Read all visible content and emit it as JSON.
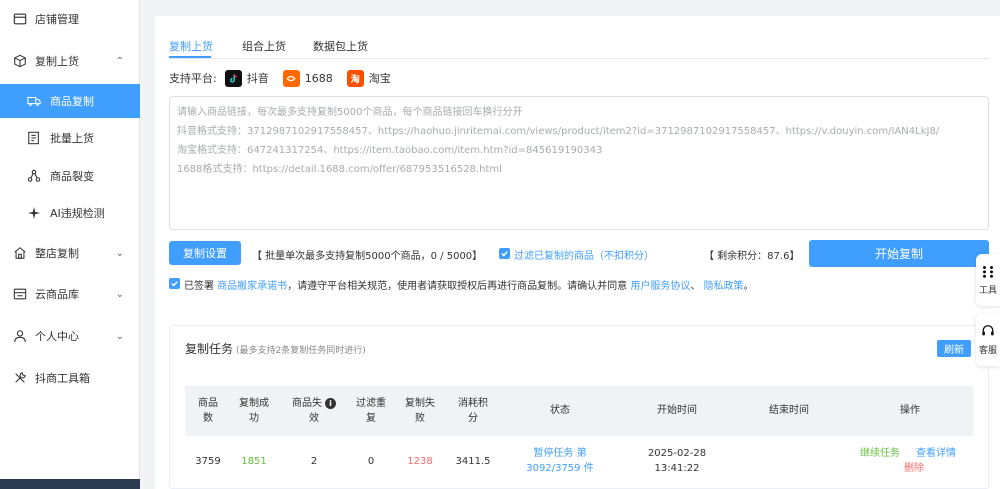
{
  "sidebar": {
    "items": [
      {
        "label": "店铺管理",
        "icon": "store-icon"
      },
      {
        "label": "复制上货",
        "icon": "box-icon",
        "arrow": "^"
      },
      {
        "label": "商品复制",
        "icon": "truck-icon",
        "active": true
      },
      {
        "label": "批量上货",
        "icon": "list-icon"
      },
      {
        "label": "商品裂变",
        "icon": "fission-icon"
      },
      {
        "label": "AI违规检测",
        "icon": "ai-check-icon"
      },
      {
        "label": "整店复制",
        "icon": "shop-copy-icon",
        "arrow": "v"
      },
      {
        "label": "云商品库",
        "icon": "cloud-library-icon",
        "arrow": "v"
      },
      {
        "label": "个人中心",
        "icon": "user-icon",
        "arrow": "v"
      },
      {
        "label": "抖商工具箱",
        "icon": "toolbox-icon"
      }
    ]
  },
  "tabs": [
    "复制上货",
    "组合上货",
    "数据包上货"
  ],
  "platforms": {
    "label": "支持平台:",
    "items": [
      {
        "name": "抖音",
        "icon": "douyin-logo-icon",
        "color": "#111111"
      },
      {
        "name": "1688",
        "icon": "alibaba-1688-logo-icon",
        "color": "#ff6a00"
      },
      {
        "name": "淘宝",
        "icon": "taobao-logo-icon",
        "color": "#ff5000",
        "glyph": "淘"
      }
    ]
  },
  "input": {
    "lines": [
      "请输入商品链接，每次最多支持复制5000个商品，每个商品链接回车换行分开",
      "抖音格式支持：3712987102917558457、https://haohuo.jinritemai.com/views/product/item2?id=3712987102917558457、https://v.douyin.com/IAN4LkJ8/",
      "淘宝格式支持：647241317254、https://item.taobao.com/item.htm?id=845619190343",
      "1688格式支持：https://detail.1688.com/offer/687953516528.html"
    ]
  },
  "actions": {
    "settings_button": "复制设置",
    "batch_limit": "【 批量单次最多支持复制5000个商品，0 / 5000】",
    "filter_copied": "过滤已复制的商品（不扣积分）",
    "points": "【 剩余积分：87.6】",
    "start_button": "开始复制"
  },
  "agreement": {
    "prefix": "已签署",
    "link1": "商品搬家承诺书",
    "middle": "，请遵守平台相关规范，使用者请获取授权后再进行商品复制。请确认并同意",
    "link2": "用户服务协议",
    "sep": "、",
    "link3": "隐私政策",
    "suffix": "。"
  },
  "tasks": {
    "title": "复制任务",
    "hint": "(最多支持2条复制任务同时进行)",
    "refresh_button": "刷新",
    "columns": [
      [
        "商品",
        "数"
      ],
      [
        "复制成",
        "功"
      ],
      [
        "商品失",
        "效"
      ],
      [
        "过滤重",
        "复"
      ],
      [
        "复制失",
        "败"
      ],
      [
        "消耗积",
        "分"
      ],
      [
        "状态"
      ],
      [
        "开始时间"
      ],
      [
        "结束时间"
      ],
      [
        "操作"
      ]
    ],
    "rows": [
      {
        "count": "3759",
        "success": "1851",
        "invalid": "2",
        "filtered": "0",
        "failed": "1238",
        "points": "3411.5",
        "status_line1": "暂停任务 第",
        "status_line2": "3092/3759 件",
        "start_date": "2025-02-28",
        "start_time": "13:41:22",
        "end_time": "",
        "op_continue": "继续任务",
        "op_detail": "查看详情",
        "op_delete": "删除"
      }
    ]
  },
  "float_tools": [
    {
      "label": "工具",
      "icon": "grid-dots-icon"
    },
    {
      "label": "客服",
      "icon": "headset-icon"
    }
  ],
  "colors": {
    "primary": "#409eff",
    "success": "#67c23a",
    "danger": "#f56c6c",
    "sidebar_bottom": "#2c3a4f"
  }
}
